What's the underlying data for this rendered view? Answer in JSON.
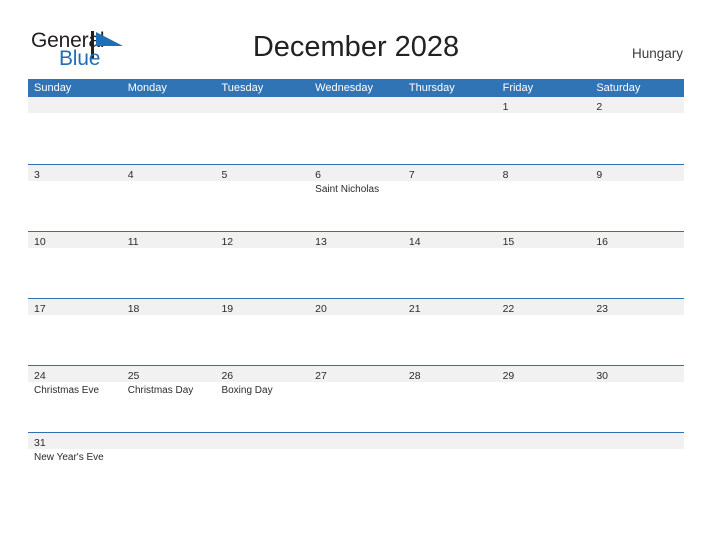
{
  "brand": {
    "name_part1": "General",
    "name_part2": "Blue",
    "flag_icon": "blue-flag-icon"
  },
  "header": {
    "title": "December 2028",
    "country": "Hungary"
  },
  "colors": {
    "header_blue": "#3174b5",
    "divider_blue": "#2e72b2",
    "band_gray": "#f1f1f1",
    "logo_blue": "#1d70b8",
    "text_dark": "#2b2b2b"
  },
  "calendar": {
    "weekdays": [
      "Sunday",
      "Monday",
      "Tuesday",
      "Wednesday",
      "Thursday",
      "Friday",
      "Saturday"
    ],
    "weeks": [
      {
        "days": [
          {
            "number": "",
            "event": ""
          },
          {
            "number": "",
            "event": ""
          },
          {
            "number": "",
            "event": ""
          },
          {
            "number": "",
            "event": ""
          },
          {
            "number": "",
            "event": ""
          },
          {
            "number": "1",
            "event": ""
          },
          {
            "number": "2",
            "event": ""
          }
        ]
      },
      {
        "days": [
          {
            "number": "3",
            "event": ""
          },
          {
            "number": "4",
            "event": ""
          },
          {
            "number": "5",
            "event": ""
          },
          {
            "number": "6",
            "event": "Saint Nicholas"
          },
          {
            "number": "7",
            "event": ""
          },
          {
            "number": "8",
            "event": ""
          },
          {
            "number": "9",
            "event": ""
          }
        ]
      },
      {
        "days": [
          {
            "number": "10",
            "event": ""
          },
          {
            "number": "11",
            "event": ""
          },
          {
            "number": "12",
            "event": ""
          },
          {
            "number": "13",
            "event": ""
          },
          {
            "number": "14",
            "event": ""
          },
          {
            "number": "15",
            "event": ""
          },
          {
            "number": "16",
            "event": ""
          }
        ]
      },
      {
        "days": [
          {
            "number": "17",
            "event": ""
          },
          {
            "number": "18",
            "event": ""
          },
          {
            "number": "19",
            "event": ""
          },
          {
            "number": "20",
            "event": ""
          },
          {
            "number": "21",
            "event": ""
          },
          {
            "number": "22",
            "event": ""
          },
          {
            "number": "23",
            "event": ""
          }
        ]
      },
      {
        "days": [
          {
            "number": "24",
            "event": "Christmas Eve"
          },
          {
            "number": "25",
            "event": "Christmas Day"
          },
          {
            "number": "26",
            "event": "Boxing Day"
          },
          {
            "number": "27",
            "event": ""
          },
          {
            "number": "28",
            "event": ""
          },
          {
            "number": "29",
            "event": ""
          },
          {
            "number": "30",
            "event": ""
          }
        ]
      },
      {
        "days": [
          {
            "number": "31",
            "event": "New Year's Eve"
          },
          {
            "number": "",
            "event": ""
          },
          {
            "number": "",
            "event": ""
          },
          {
            "number": "",
            "event": ""
          },
          {
            "number": "",
            "event": ""
          },
          {
            "number": "",
            "event": ""
          },
          {
            "number": "",
            "event": ""
          }
        ]
      }
    ]
  }
}
